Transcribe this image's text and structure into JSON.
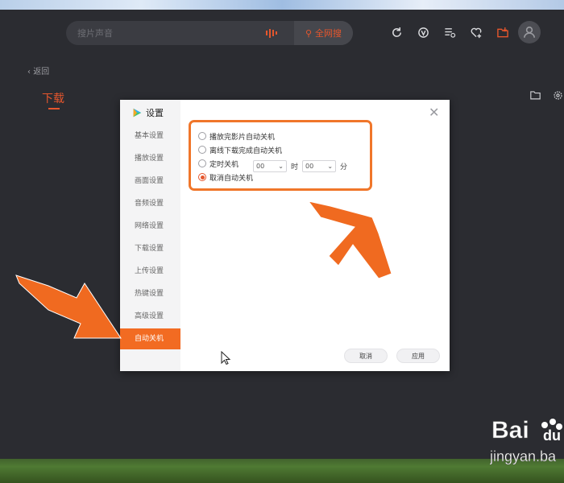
{
  "search": {
    "placeholder": "搜片声音",
    "global_search_label": "全网搜"
  },
  "nav": {
    "back_label": "返回",
    "page_title": "下载"
  },
  "dialog": {
    "title": "设置",
    "sidebar_items": [
      {
        "label": "基本设置",
        "active": false
      },
      {
        "label": "播放设置",
        "active": false
      },
      {
        "label": "画面设置",
        "active": false
      },
      {
        "label": "音频设置",
        "active": false
      },
      {
        "label": "网络设置",
        "active": false
      },
      {
        "label": "下载设置",
        "active": false
      },
      {
        "label": "上传设置",
        "active": false
      },
      {
        "label": "热键设置",
        "active": false
      },
      {
        "label": "高级设置",
        "active": false
      },
      {
        "label": "自动关机",
        "active": true
      }
    ],
    "options": [
      {
        "label": "播放完影片自动关机",
        "checked": false
      },
      {
        "label": "离线下载完成自动关机",
        "checked": false
      },
      {
        "label": "定时关机",
        "checked": false
      },
      {
        "label": "取消自动关机",
        "checked": true
      }
    ],
    "timer": {
      "hour_value": "00",
      "hour_unit": "时",
      "minute_value": "00",
      "minute_unit": "分"
    },
    "cancel_label": "取消",
    "apply_label": "应用"
  },
  "icons": {
    "refresh": "refresh-icon",
    "vip": "v-badge-icon",
    "list": "playlist-icon",
    "favorite": "heart-plus-icon",
    "download": "download-folder-icon"
  },
  "colors": {
    "accent": "#e5562d",
    "highlight": "#f0762a"
  }
}
